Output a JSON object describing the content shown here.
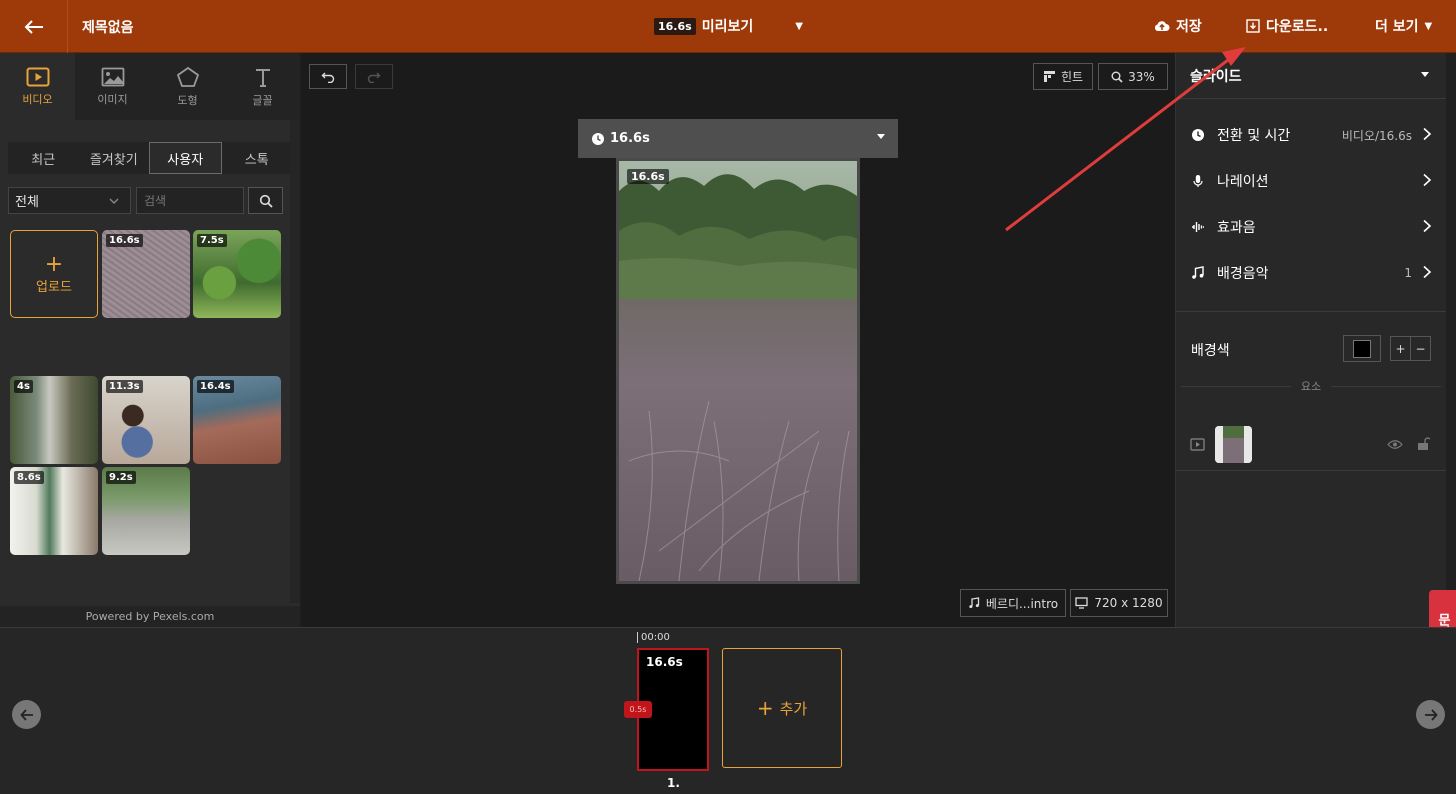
{
  "header": {
    "title": "제목없음",
    "preview_duration": "16.6s",
    "preview_label": "미리보기",
    "save_label": "저장",
    "download_label": "다운로드..",
    "more_label": "더 보기"
  },
  "left_panel": {
    "categories": [
      {
        "label": "비디오",
        "icon": "video-icon"
      },
      {
        "label": "이미지",
        "icon": "image-icon"
      },
      {
        "label": "도형",
        "icon": "pentagon-icon"
      },
      {
        "label": "글꼴",
        "icon": "text-icon"
      }
    ],
    "source_tabs": [
      "최근",
      "즐겨찾기",
      "사용자",
      "스톡"
    ],
    "active_source_tab": "사용자",
    "filter_value": "전체",
    "search_placeholder": "검색",
    "upload_label": "업로드",
    "thumbnails": [
      {
        "duration": "16.6s"
      },
      {
        "duration": "7.5s"
      },
      {
        "duration": "4s"
      },
      {
        "duration": "11.3s"
      },
      {
        "duration": "16.4s"
      },
      {
        "duration": "8.6s"
      },
      {
        "duration": "9.2s"
      }
    ],
    "powered_by": "Powered by Pexels.com"
  },
  "canvas": {
    "hint_label": "힌트",
    "zoom": "33%",
    "slide_duration": "16.6s",
    "clip_duration": "16.6s",
    "music_label": "베르디...intro",
    "resolution": "720 x 1280"
  },
  "right_panel": {
    "heading": "슬라이드",
    "rows": [
      {
        "label": "전환 및 시간",
        "value": "비디오/16.6s",
        "icon": "clock-icon"
      },
      {
        "label": "나레이션",
        "value": "",
        "icon": "microphone-icon"
      },
      {
        "label": "효과음",
        "value": "",
        "icon": "waveform-icon"
      },
      {
        "label": "배경음악",
        "value": "1",
        "icon": "music-note-icon"
      }
    ],
    "background_color_label": "배경색",
    "background_color": "#000000",
    "plus": "+",
    "minus": "−",
    "elements_label": "요소"
  },
  "help_tab": "문의",
  "timeline": {
    "time": "00:00",
    "clip_duration": "16.6s",
    "transition": "0.5s",
    "add_label": "추가",
    "slide_index": "1."
  },
  "colors": {
    "header_bg": "#9e3a0a",
    "accent": "#e8a33a",
    "selected_clip": "#c0161b",
    "help_tab": "#d8323f",
    "annotation_arrow": "#e03c3c"
  }
}
